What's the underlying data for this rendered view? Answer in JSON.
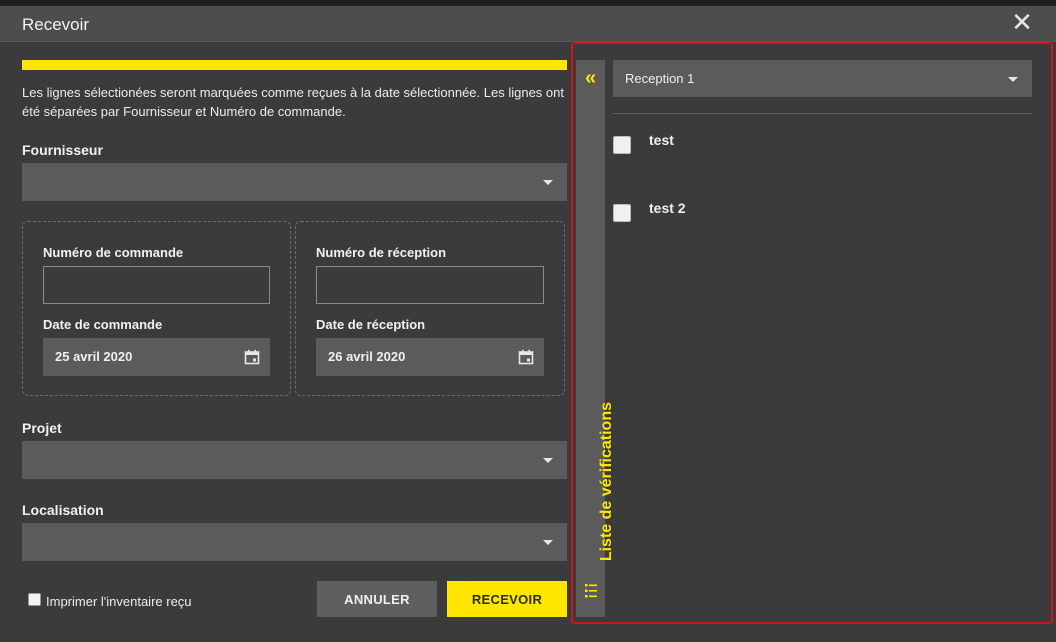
{
  "dialog": {
    "title": "Recevoir",
    "close_icon": "close-icon"
  },
  "form": {
    "description": "Les lignes sélectionées seront marquées comme reçues à la date sélectionnée. Les lignes ont été séparées par Fournisseur et Numéro de commande.",
    "supplier_label": "Fournisseur",
    "supplier_value": "",
    "order_number_label": "Numéro de commande",
    "order_number_value": "",
    "order_date_label": "Date de commande",
    "order_date_value": "25 avril 2020",
    "reception_number_label": "Numéro de réception",
    "reception_number_value": "",
    "reception_date_label": "Date de réception",
    "reception_date_value": "26 avril 2020",
    "project_label": "Projet",
    "project_value": "",
    "location_label": "Localisation",
    "location_value": "",
    "print_inventory_label": "Imprimer l'inventaire reçu",
    "print_inventory_checked": false,
    "cancel_label": "ANNULER",
    "receive_label": "RECEVOIR"
  },
  "checklist_panel": {
    "tab_label": "Liste de vérifications",
    "collapse_icon": "double-chevron-left-icon",
    "list_icon": "checklist-icon",
    "selected": "Reception 1",
    "items": [
      {
        "label": "test",
        "checked": false
      },
      {
        "label": "test 2",
        "checked": false
      }
    ]
  },
  "colors": {
    "accent": "#ffe600",
    "highlight_border": "#d0141c",
    "background": "#3b3b3b",
    "field": "#5b5b5b"
  }
}
